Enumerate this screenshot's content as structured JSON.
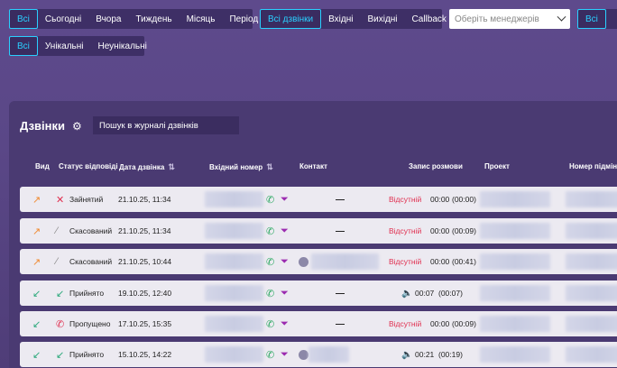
{
  "period_filter": [
    "Всі",
    "Сьогодні",
    "Вчора",
    "Тиждень",
    "Місяць",
    "Період"
  ],
  "type_filter": [
    "Всі дзвінки",
    "Вхідні",
    "Вихідні",
    "Callback"
  ],
  "manager_select": {
    "placeholder": "Оберіть менеджерів"
  },
  "extra_filter": "Всі",
  "unique_filter": [
    "Всі",
    "Унікальні",
    "Неунікальні"
  ],
  "calls": {
    "title": "Дзвінки",
    "search_placeholder": "Пошук в журналі дзвінків"
  },
  "columns": {
    "view": "Вид",
    "status": "Статус відповіді",
    "date": "Дата дзвінка",
    "incoming": "Вхідний номер",
    "contact": "Контакт",
    "record": "Запис розмови",
    "project": "Проект",
    "number": "Номер підмінн"
  },
  "rows": [
    {
      "direction": "outgoing",
      "status": "Зайнятий",
      "status_icon": "missed",
      "date": "21.10.25, 11:34",
      "contact": "—",
      "record": "Відсутній",
      "dur1": "00:00",
      "dur2": "(00:00)"
    },
    {
      "direction": "outgoing",
      "status": "Скасований",
      "status_icon": "cancelled",
      "date": "21.10.25, 11:34",
      "contact": "—",
      "record": "Відсутній",
      "dur1": "00:00",
      "dur2": "(00:09)"
    },
    {
      "direction": "outgoing",
      "status": "Скасований",
      "status_icon": "cancelled",
      "date": "21.10.25, 10:44",
      "contact": "avatar",
      "record": "Відсутній",
      "dur1": "00:00",
      "dur2": "(00:41)"
    },
    {
      "direction": "incoming",
      "status": "Прийнято",
      "status_icon": "accepted",
      "date": "19.10.25, 12:40",
      "contact": "—",
      "record": "speaker",
      "dur1": "00:07",
      "dur2": "(00:07)"
    },
    {
      "direction": "incoming",
      "status": "Пропущено",
      "status_icon": "missed",
      "date": "17.10.25, 15:35",
      "contact": "—",
      "record": "Відсутній",
      "dur1": "00:00",
      "dur2": "(00:09)"
    },
    {
      "direction": "incoming",
      "status": "Прийнято",
      "status_icon": "accepted",
      "date": "15.10.25, 14:22",
      "contact": "avatar",
      "record": "speaker",
      "dur1": "00:21",
      "dur2": "(00:19)"
    }
  ],
  "colors": {
    "accent": "#2ad0ff",
    "missing": "#e03050",
    "phone": "#2aa860",
    "filter": "#9b2bb0"
  }
}
